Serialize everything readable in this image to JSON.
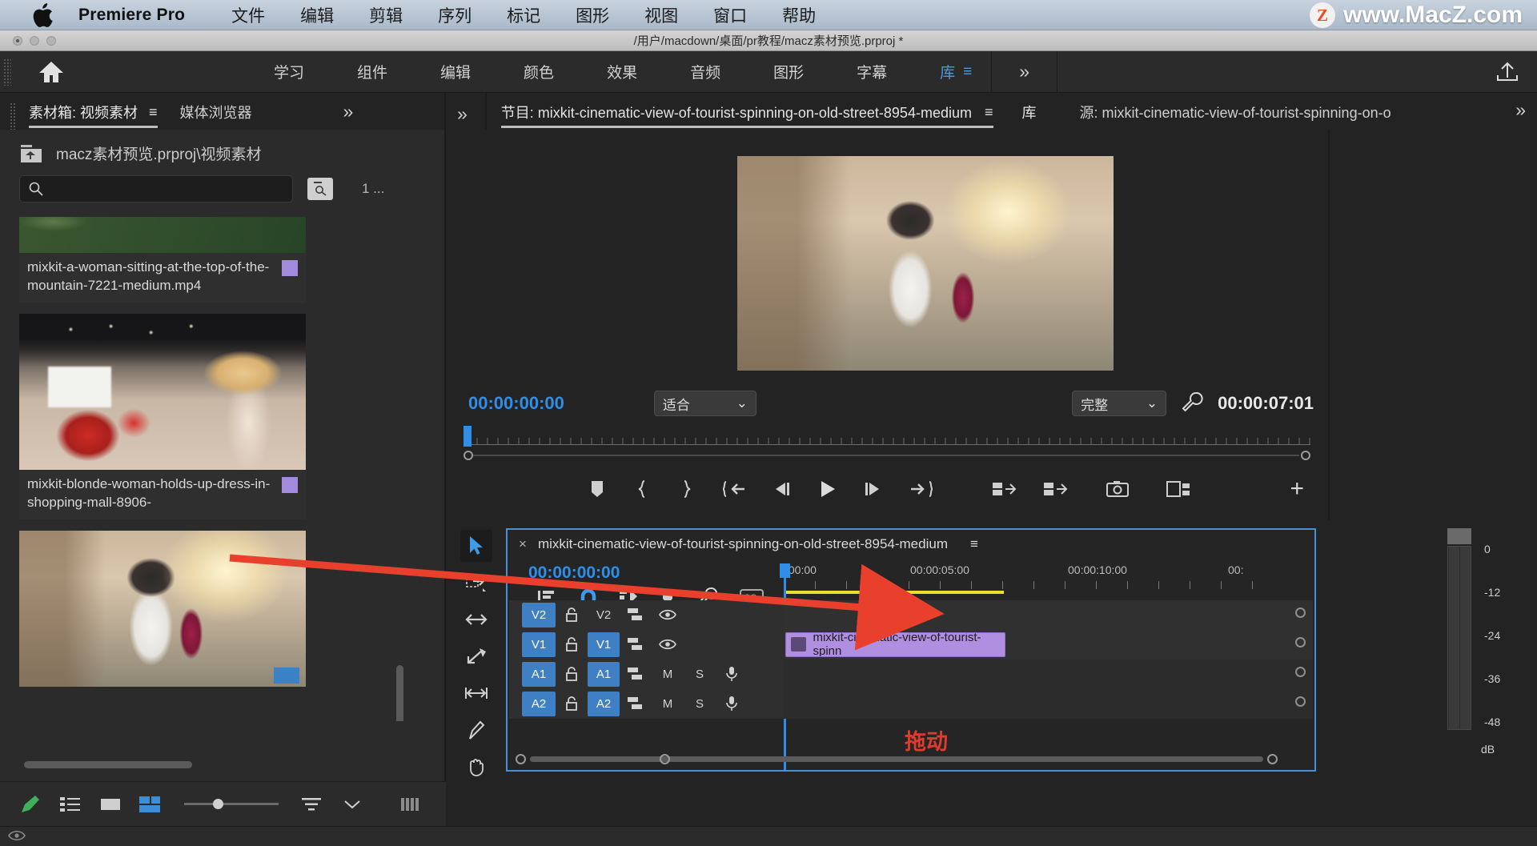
{
  "macmenu": {
    "app_name": "Premiere Pro",
    "items": [
      "文件",
      "编辑",
      "剪辑",
      "序列",
      "标记",
      "图形",
      "视图",
      "窗口",
      "帮助"
    ],
    "watermark_badge": "Z",
    "watermark_text": "www.MacZ.com"
  },
  "titlebar": {
    "path": "/用户/macdown/桌面/pr教程/macz素材预览.prproj *"
  },
  "workspace": {
    "home_icon": "home-icon",
    "tabs": [
      {
        "label": "学习",
        "active": false
      },
      {
        "label": "组件",
        "active": false
      },
      {
        "label": "编辑",
        "active": false
      },
      {
        "label": "颜色",
        "active": false
      },
      {
        "label": "效果",
        "active": false
      },
      {
        "label": "音频",
        "active": false
      },
      {
        "label": "图形",
        "active": false
      },
      {
        "label": "字幕",
        "active": false
      },
      {
        "label": "库",
        "active": true
      }
    ],
    "menu_icon": "≡",
    "more": "»",
    "export_icon": "export-icon"
  },
  "project_panel": {
    "tabs": [
      {
        "label": "素材箱: 视频素材",
        "active": true,
        "menu": "≡"
      },
      {
        "label": "媒体浏览器",
        "active": false
      }
    ],
    "path": "macz素材预览.prproj\\视频素材",
    "search_placeholder": "",
    "search_value": "",
    "count_label": "1 ...",
    "items": [
      {
        "name": "mixkit-a-woman-sitting-at-the-top-of-the-mountain-7221-medium.mp4",
        "swatch": "#a28bdc",
        "thumb": "mountain"
      },
      {
        "name": "mixkit-blonde-woman-holds-up-dress-in-shopping-mall-8906-",
        "swatch": "#a28bdc",
        "thumb": "mall"
      },
      {
        "name": "",
        "swatch": "",
        "thumb": "street"
      }
    ],
    "bottom_icons": [
      "pen-icon",
      "list-view-icon",
      "icon-view-icon",
      "freeform-view-icon",
      "zoom-slider",
      "sort-icon",
      "chevron-down-icon",
      "grid-icon"
    ]
  },
  "monitor": {
    "tabs": [
      {
        "label": "节目: mixkit-cinematic-view-of-tourist-spinning-on-old-street-8954-medium",
        "active": true,
        "menu": "≡"
      },
      {
        "label": "库",
        "active": false
      },
      {
        "label": "源: mixkit-cinematic-view-of-tourist-spinning-on-o",
        "active": false
      }
    ],
    "more": "»",
    "timecode_current": "00:00:00:00",
    "zoom_level": "适合",
    "quality": "完整",
    "wrench_icon": "wrench-icon",
    "timecode_duration": "00:00:07:01",
    "buttons": [
      "mark-in-out-icon",
      "mark-in-icon",
      "mark-out-icon",
      "go-to-in-icon",
      "step-back-icon",
      "play-icon",
      "step-forward-icon",
      "go-to-out-icon",
      "lift-icon",
      "extract-icon",
      "export-frame-icon",
      "comparison-view-icon"
    ],
    "add_button": "+"
  },
  "timeline": {
    "sequence_name": "mixkit-cinematic-view-of-tourist-spinning-on-old-street-8954-medium",
    "close_icon": "×",
    "menu_icon": "≡",
    "timecode": "00:00:00:00",
    "tool_icons": [
      "selection-tool-icon",
      "track-select-forward-icon",
      "ripple-edit-icon",
      "rolling-edit-icon",
      "slip-tool-icon",
      "pen-tool-icon",
      "hand-tool-icon"
    ],
    "toolbar_icons": [
      "nest-sequence-icon",
      "snap-icon",
      "linked-selection-icon",
      "add-marker-icon",
      "timeline-settings-icon",
      "captions-icon"
    ],
    "ruler_labels": [
      ":00:00",
      "00:00:05:00",
      "00:00:10:00",
      "00:"
    ],
    "tracks": [
      {
        "name": "V2",
        "type": "video",
        "clip": null
      },
      {
        "name": "V1",
        "type": "video",
        "clip": "mixkit-cinematic-view-of-tourist-spinn"
      },
      {
        "name": "A1",
        "type": "audio",
        "mute": "M",
        "solo": "S",
        "clip": null
      },
      {
        "name": "A2",
        "type": "audio",
        "mute": "M",
        "solo": "S",
        "clip": null
      }
    ]
  },
  "audio_meter": {
    "scale": [
      "0",
      "-12",
      "-24",
      "-36",
      "-48"
    ],
    "unit": "dB"
  },
  "annotation": {
    "label": "拖动",
    "color": "#e03c2e"
  }
}
